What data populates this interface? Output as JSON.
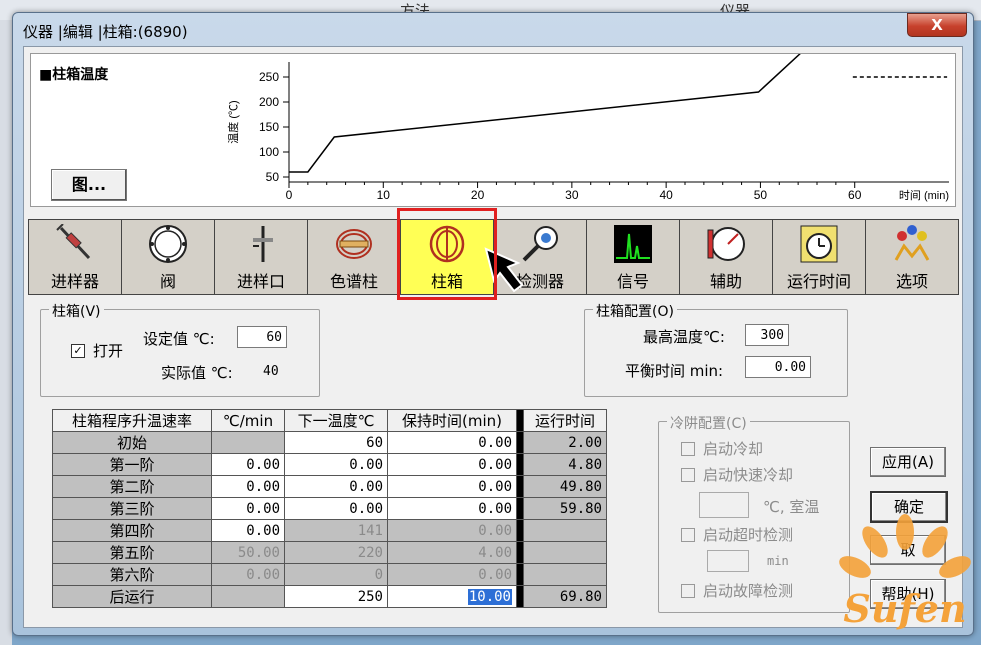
{
  "background": {
    "tab1": "方法",
    "tab2": "仪器"
  },
  "window": {
    "title": "仪器 |编辑 |柱箱:(6890)",
    "close_label": "X"
  },
  "chart": {
    "title": "■柱箱温度",
    "figure_button": "图...",
    "ylabel": "温度 (℃)",
    "xlabel": "时间 (min)"
  },
  "chart_data": {
    "type": "line",
    "title": "柱箱温度",
    "xlabel": "时间 (min)",
    "ylabel": "温度 (℃)",
    "xlim": [
      0,
      70
    ],
    "ylim": [
      40,
      280
    ],
    "xticks": [
      0,
      10,
      20,
      30,
      40,
      50,
      60
    ],
    "yticks": [
      50,
      100,
      150,
      200,
      250
    ],
    "series": [
      {
        "style": "solid",
        "x": [
          0,
          2,
          4.8,
          49.8,
          54.4,
          59.8
        ],
        "y": [
          60,
          60,
          130,
          220,
          300,
          300
        ]
      },
      {
        "style": "dashed",
        "x": [
          59.8,
          69.8
        ],
        "y": [
          250,
          250
        ]
      }
    ],
    "grid": false,
    "legend": "none"
  },
  "toolbar": {
    "items": [
      {
        "label": "进样器"
      },
      {
        "label": "阀"
      },
      {
        "label": "进样口"
      },
      {
        "label": "色谱柱"
      },
      {
        "label": "柱箱"
      },
      {
        "label": "检测器"
      },
      {
        "label": "信号"
      },
      {
        "label": "辅助"
      },
      {
        "label": "运行时间"
      },
      {
        "label": "选项"
      }
    ]
  },
  "oven": {
    "group_title": "柱箱(V)",
    "enable_label": "打开",
    "setpoint_label": "设定值 ℃:",
    "setpoint_value": "60",
    "actual_label": "实际值 ℃:",
    "actual_value": "40"
  },
  "oven_config": {
    "group_title": "柱箱配置(O)",
    "max_temp_label": "最高温度℃:",
    "max_temp_value": "300",
    "equil_label": "平衡时间 min:",
    "equil_value": "0.00"
  },
  "program_table": {
    "headers": [
      "柱箱程序升温速率",
      "℃/min",
      "下一温度℃",
      "保持时间(min)",
      "运行时间"
    ],
    "rows": [
      {
        "label": "初始",
        "rate": "",
        "next": "60",
        "hold": "0.00",
        "run": "2.00"
      },
      {
        "label": "第一阶",
        "rate": "0.00",
        "next": "0.00",
        "hold": "0.00",
        "run": "4.80"
      },
      {
        "label": "第二阶",
        "rate": "0.00",
        "next": "0.00",
        "hold": "0.00",
        "run": "49.80"
      },
      {
        "label": "第三阶",
        "rate": "0.00",
        "next": "0.00",
        "hold": "0.00",
        "run": "59.80"
      },
      {
        "label": "第四阶",
        "rate": "0.00",
        "next": "141",
        "hold": "0.00",
        "run": ""
      },
      {
        "label": "第五阶",
        "rate": "50.00",
        "next": "220",
        "hold": "4.00",
        "run": ""
      },
      {
        "label": "第六阶",
        "rate": "0.00",
        "next": "0",
        "hold": "0.00",
        "run": ""
      },
      {
        "label": "后运行",
        "rate": "",
        "next": "250",
        "hold": "10.00",
        "run": "69.80"
      }
    ]
  },
  "cryo": {
    "group_title": "冷阱配置(C)",
    "cryo_label": "启动冷却",
    "quick_label": "启动快速冷却",
    "temp_unit": "℃, 室温",
    "timeout_label": "启动超时检测",
    "timeout_unit": "min",
    "fault_label": "启动故障检测"
  },
  "buttons": {
    "apply": "应用(A)",
    "ok": "确定",
    "cancel": "取",
    "help": "帮助(H)"
  },
  "watermark": {
    "text": "Sufen"
  }
}
